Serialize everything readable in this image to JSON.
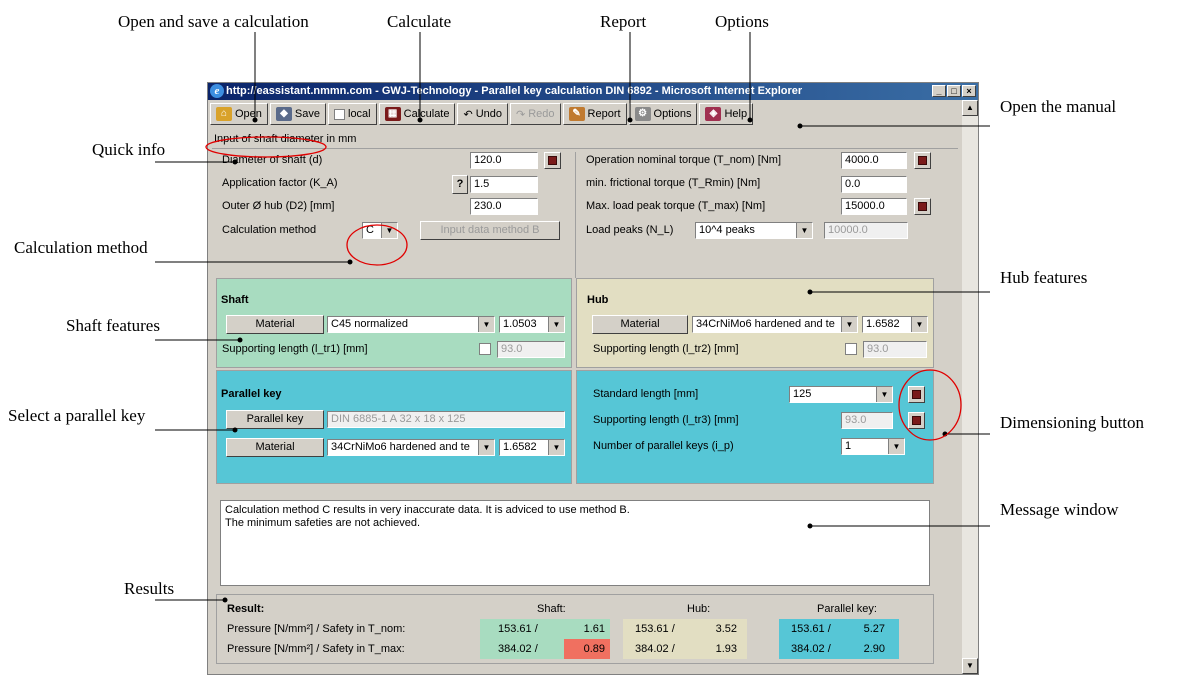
{
  "annotations": {
    "open_save": "Open and save a calculation",
    "calculate": "Calculate",
    "report": "Report",
    "options": "Options",
    "open_manual": "Open the manual",
    "quick_info": "Quick info",
    "calc_method": "Calculation method",
    "hub_features": "Hub features",
    "shaft_features": "Shaft features",
    "select_key": "Select a parallel key",
    "dimensioning": "Dimensioning button",
    "message_window": "Message window",
    "results": "Results"
  },
  "window": {
    "title": "http://eassistant.nmmn.com - GWJ-Technology - Parallel key calculation DIN 6892 - Microsoft Internet Explorer"
  },
  "toolbar": {
    "open": "Open",
    "save": "Save",
    "local": "local",
    "calculate": "Calculate",
    "undo": "Undo",
    "redo": "Redo",
    "report": "Report",
    "options": "Options",
    "help": "Help"
  },
  "quick_info": "Input of shaft diameter in mm",
  "inputs": {
    "diameter_label": "Diameter of shaft (d)",
    "diameter_value": "120.0",
    "app_factor_label": "Application factor (K_A)",
    "app_factor_help": "?",
    "app_factor_value": "1.5",
    "outer_hub_label": "Outer Ø hub (D2) [mm]",
    "outer_hub_value": "230.0",
    "calc_method_label": "Calculation method",
    "calc_method_value": "C",
    "input_method_b": "Input data method B",
    "torque_nom_label": "Operation nominal torque (T_nom) [Nm]",
    "torque_nom_value": "4000.0",
    "torque_rmin_label": "min. frictional torque (T_Rmin) [Nm]",
    "torque_rmin_value": "0.0",
    "torque_max_label": "Max. load peak torque (T_max) [Nm]",
    "torque_max_value": "15000.0",
    "load_peaks_label": "Load peaks (N_L)",
    "load_peaks_value": "10^4 peaks",
    "load_peaks_count": "10000.0"
  },
  "shaft": {
    "heading": "Shaft",
    "material_btn": "Material",
    "material_value": "C45 normalized",
    "material_no": "1.0503",
    "support_label": "Supporting length (l_tr1) [mm]",
    "support_value": "93.0"
  },
  "hub": {
    "heading": "Hub",
    "material_btn": "Material",
    "material_value": "34CrNiMo6 hardened and te",
    "material_no": "1.6582",
    "support_label": "Supporting length (l_tr2) [mm]",
    "support_value": "93.0"
  },
  "key": {
    "heading": "Parallel key",
    "key_btn": "Parallel key",
    "key_value": "DIN 6885-1 A 32 x 18 x 125",
    "material_btn": "Material",
    "material_value": "34CrNiMo6 hardened and te",
    "material_no": "1.6582",
    "std_length_label": "Standard length [mm]",
    "std_length_value": "125",
    "support_label": "Supporting length (l_tr3) [mm]",
    "support_value": "93.0",
    "count_label": "Number of parallel keys (i_p)",
    "count_value": "1"
  },
  "messages": [
    "Calculation method C results in very inaccurate data. It is adviced to use method B.",
    "The minimum safeties are not achieved."
  ],
  "result": {
    "title": "Result:",
    "col_shaft": "Shaft:",
    "col_hub": "Hub:",
    "col_key": "Parallel key:",
    "row1_label": "Pressure [N/mm²] / Safety in T_nom:",
    "row2_label": "Pressure [N/mm²] / Safety in T_max:",
    "row1": {
      "shaft_p": "153.61  /",
      "shaft_s": "1.61",
      "hub_p": "153.61  /",
      "hub_s": "3.52",
      "key_p": "153.61  /",
      "key_s": "5.27"
    },
    "row2": {
      "shaft_p": "384.02  /",
      "shaft_s": "0.89",
      "hub_p": "384.02  /",
      "hub_s": "1.93",
      "key_p": "384.02  /",
      "key_s": "2.90"
    }
  },
  "colors": {
    "shaft": "#a8dcc0",
    "hub": "#e2dec2",
    "key": "#56c6d6",
    "warning": "#f07060",
    "highlight_ellipse": "#e00000"
  }
}
